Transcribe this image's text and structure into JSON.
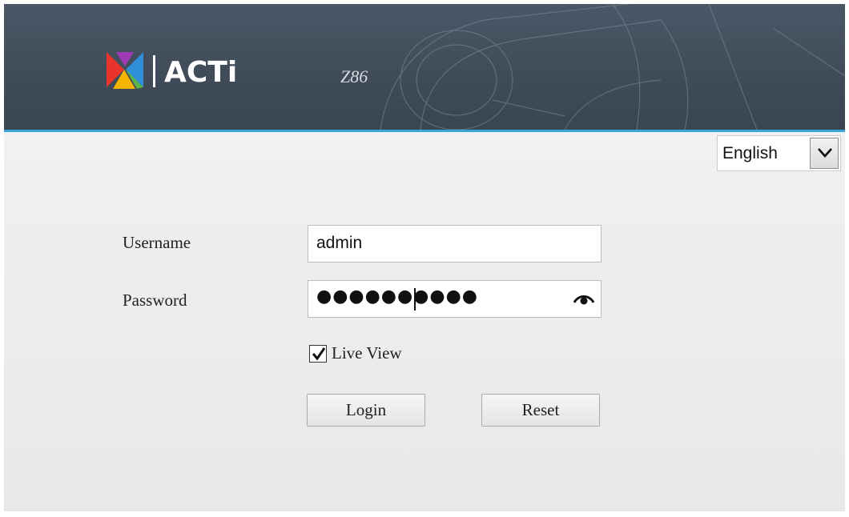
{
  "header": {
    "brand": "ACTi",
    "model": "Z86"
  },
  "language": {
    "selected": "English"
  },
  "form": {
    "username_label": "Username",
    "username_value": "admin",
    "password_label": "Password",
    "password_masked": "●●●●●●●●●●",
    "live_view_label": "Live View",
    "live_view_checked": true
  },
  "buttons": {
    "login": "Login",
    "reset": "Reset"
  },
  "colors": {
    "header_bg": "#43505e",
    "accent_line": "#3aa6d6",
    "page_bg": "#eceef0"
  },
  "icons": {
    "logo": "acti-logo-icon",
    "dropdown": "chevron-down-icon",
    "reveal_password": "eye-icon",
    "checkbox": "checkmark-icon"
  }
}
